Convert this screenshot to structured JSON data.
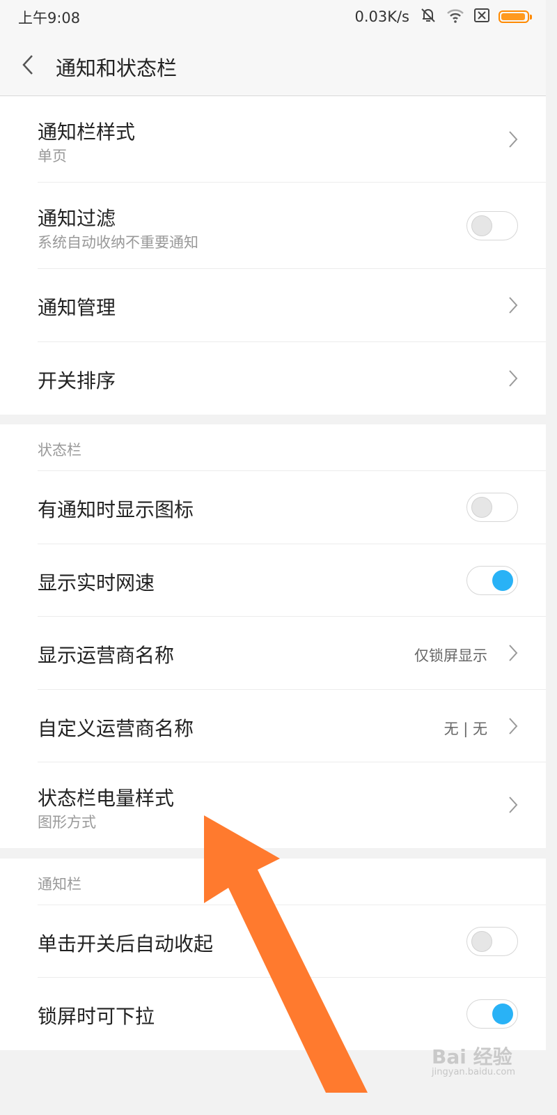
{
  "status_bar": {
    "time": "上午9:08",
    "net_speed": "0.03K/s",
    "icons": [
      "mute-icon",
      "wifi-icon",
      "no-sim-icon",
      "battery-icon"
    ],
    "battery_color": "#ff9a1f"
  },
  "header": {
    "title": "通知和状态栏"
  },
  "group1": {
    "items": [
      {
        "label": "通知栏样式",
        "sub": "单页"
      },
      {
        "label": "通知过滤",
        "sub": "系统自动收纳不重要通知",
        "toggle": false
      },
      {
        "label": "通知管理"
      },
      {
        "label": "开关排序"
      }
    ]
  },
  "group2": {
    "header": "状态栏",
    "items": [
      {
        "label": "有通知时显示图标",
        "toggle": false
      },
      {
        "label": "显示实时网速",
        "toggle": true
      },
      {
        "label": "显示运营商名称",
        "value": "仅锁屏显示"
      },
      {
        "label": "自定义运营商名称",
        "value": "无 | 无"
      },
      {
        "label": "状态栏电量样式",
        "sub": "图形方式"
      }
    ]
  },
  "group3": {
    "header": "通知栏",
    "items": [
      {
        "label": "单击开关后自动收起",
        "toggle": false
      },
      {
        "label": "锁屏时可下拉",
        "toggle": true
      }
    ]
  },
  "overlay": {
    "arrow_color": "#ff7a2e",
    "watermark": "Bai 经验",
    "watermark_url": "jingyan.baidu.com"
  },
  "colors": {
    "toggle_on": "#29b2f6",
    "accent": "#ff7a2e"
  }
}
